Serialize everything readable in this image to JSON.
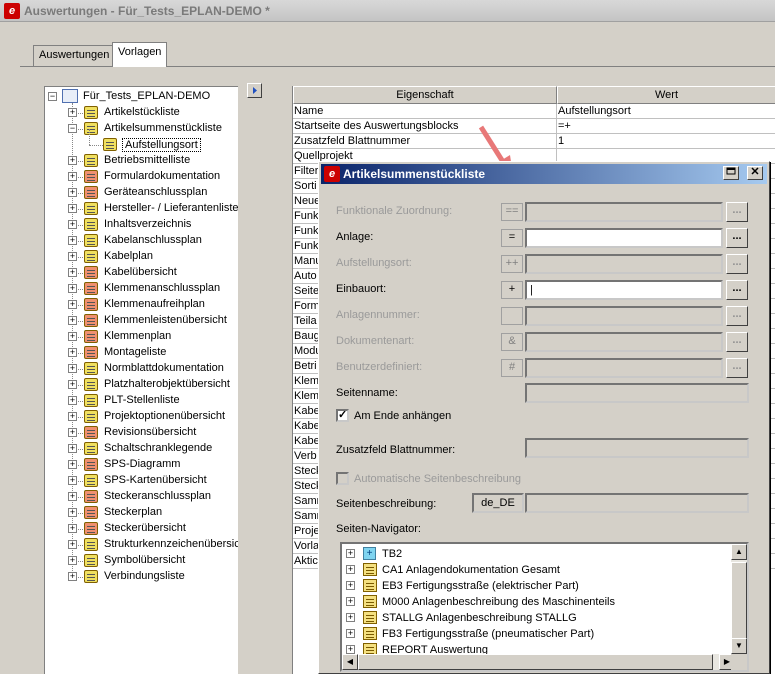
{
  "window": {
    "title": "Auswertungen - Für_Tests_EPLAN-DEMO *"
  },
  "tabs": [
    {
      "label": "Auswertungen"
    },
    {
      "label": "Vorlagen"
    }
  ],
  "tree": {
    "root": "Für_Tests_EPLAN-DEMO",
    "items": [
      {
        "label": "Artikelstückliste",
        "color": "#f0e060"
      },
      {
        "label": "Artikelsummenstückliste",
        "color": "#f0e060"
      },
      {
        "label": "Aufstellungsort",
        "color": "#f0e060",
        "child": true,
        "selected": true
      },
      {
        "label": "Betriebsmittelliste",
        "color": "#f0e060"
      },
      {
        "label": "Formulardokumentation",
        "color": "#f09070"
      },
      {
        "label": "Geräteanschlussplan",
        "color": "#f09070"
      },
      {
        "label": "Hersteller- / Lieferantenliste",
        "color": "#f0e060"
      },
      {
        "label": "Inhaltsverzeichnis",
        "color": "#f0e060"
      },
      {
        "label": "Kabelanschlussplan",
        "color": "#f0e060"
      },
      {
        "label": "Kabelplan",
        "color": "#f0e060"
      },
      {
        "label": "Kabelübersicht",
        "color": "#f09070"
      },
      {
        "label": "Klemmenanschlussplan",
        "color": "#f09070"
      },
      {
        "label": "Klemmenaufreihplan",
        "color": "#f09070"
      },
      {
        "label": "Klemmenleistenübersicht",
        "color": "#f09070"
      },
      {
        "label": "Klemmenplan",
        "color": "#f09070"
      },
      {
        "label": "Montageliste",
        "color": "#f09070"
      },
      {
        "label": "Normblattdokumentation",
        "color": "#f0e060"
      },
      {
        "label": "Platzhalterobjektübersicht",
        "color": "#f0e060"
      },
      {
        "label": "PLT-Stellenliste",
        "color": "#f0e060"
      },
      {
        "label": "Projektoptionenübersicht",
        "color": "#f0e060"
      },
      {
        "label": "Revisionsübersicht",
        "color": "#f09070"
      },
      {
        "label": "Schaltschranklegende",
        "color": "#f0e060"
      },
      {
        "label": "SPS-Diagramm",
        "color": "#f09070"
      },
      {
        "label": "SPS-Kartenübersicht",
        "color": "#f0e060"
      },
      {
        "label": "Steckeranschlussplan",
        "color": "#f09070"
      },
      {
        "label": "Steckerplan",
        "color": "#f09070"
      },
      {
        "label": "Steckerübersicht",
        "color": "#f09070"
      },
      {
        "label": "Strukturkennzeichenübersicht",
        "color": "#f0e060"
      },
      {
        "label": "Symbolübersicht",
        "color": "#f0e060"
      },
      {
        "label": "Verbindungsliste",
        "color": "#f0e060"
      }
    ]
  },
  "grid": {
    "col_property": "Eigenschaft",
    "col_value": "Wert",
    "rows": [
      {
        "k": "Name",
        "v": "Aufstellungsort"
      },
      {
        "k": "Startseite des Auswertungsblocks",
        "v": "=+"
      },
      {
        "k": "Zusatzfeld Blattnummer",
        "v": "1"
      },
      {
        "k": "Quellprojekt",
        "v": ""
      },
      {
        "k": "Filter",
        "v": ""
      },
      {
        "k": "Sorti",
        "v": ""
      },
      {
        "k": "Neue",
        "v": ""
      },
      {
        "k": "Funk",
        "v": ""
      },
      {
        "k": "Funk",
        "v": ""
      },
      {
        "k": "Funk",
        "v": ""
      },
      {
        "k": "Manu",
        "v": ""
      },
      {
        "k": "Auto",
        "v": ""
      },
      {
        "k": "Seite",
        "v": ""
      },
      {
        "k": "Form",
        "v": ""
      },
      {
        "k": "Teila",
        "v": ""
      },
      {
        "k": "Baug",
        "v": ""
      },
      {
        "k": "Modu",
        "v": ""
      },
      {
        "k": "Betri",
        "v": ""
      },
      {
        "k": "Klem",
        "v": ""
      },
      {
        "k": "Klem",
        "v": ""
      },
      {
        "k": "Kabe",
        "v": ""
      },
      {
        "k": "Kabe",
        "v": ""
      },
      {
        "k": "Kabe",
        "v": ""
      },
      {
        "k": "Verb",
        "v": ""
      },
      {
        "k": "Steck",
        "v": ""
      },
      {
        "k": "Steck",
        "v": ""
      },
      {
        "k": "Samm",
        "v": ""
      },
      {
        "k": "Samm",
        "v": ""
      },
      {
        "k": "Proje",
        "v": ""
      },
      {
        "k": "Vorla",
        "v": ""
      },
      {
        "k": "Aktic",
        "v": ""
      }
    ]
  },
  "dialog": {
    "title": "Artikelsummenstückliste",
    "fields": [
      {
        "label": "Funktionale Zuordnung:",
        "prefix": "==",
        "value": "",
        "enabled": false
      },
      {
        "label": "Anlage:",
        "prefix": "=",
        "value": "",
        "enabled": true
      },
      {
        "label": "Aufstellungsort:",
        "prefix": "++",
        "value": "",
        "enabled": false
      },
      {
        "label": "Einbauort:",
        "prefix": "+",
        "value": "",
        "enabled": true
      },
      {
        "label": "Anlagennummer:",
        "prefix": "",
        "value": "",
        "enabled": false
      },
      {
        "label": "Dokumentenart:",
        "prefix": "&",
        "value": "",
        "enabled": false
      },
      {
        "label": "Benutzerdefiniert:",
        "prefix": "#",
        "value": "",
        "enabled": false
      }
    ],
    "browse_label": "...",
    "seitenname_label": "Seitenname:",
    "am_ende_label": "Am Ende anhängen",
    "zusatzfeld_label": "Zusatzfeld Blattnummer:",
    "auto_beschreibung_label": "Automatische Seitenbeschreibung",
    "seitenbeschreibung_label": "Seitenbeschreibung:",
    "lang": "de_DE",
    "navigator_label": "Seiten-Navigator:",
    "navigator_items": [
      {
        "label": "TB2",
        "special": true
      },
      {
        "label": "CA1 Anlagendokumentation Gesamt"
      },
      {
        "label": "EB3 Fertigungsstraße (elektrischer Part)"
      },
      {
        "label": "M000 Anlagenbeschreibung des Maschinenteils"
      },
      {
        "label": "STALLG Anlagenbeschreibung STALLG"
      },
      {
        "label": "FB3 Fertigungsstraße (pneumatischer Part)"
      },
      {
        "label": "REPORT Auswertung"
      }
    ]
  }
}
